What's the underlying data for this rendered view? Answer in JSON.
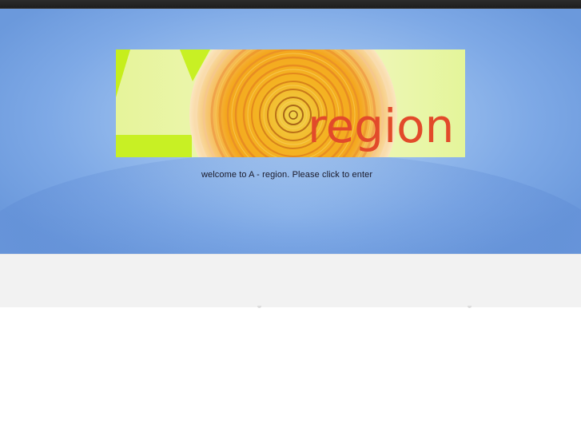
{
  "banner": {
    "logo_text": "region",
    "colors": {
      "lime": "#c8f024",
      "pale_green": "#e9f7a2",
      "orange": "#f4a21e",
      "swirl_center": "#f1c232",
      "text_red": "#e24a2a"
    }
  },
  "welcome": {
    "text": "welcome to A - region. Please click to enter"
  },
  "colors": {
    "top_bar": "#232323",
    "hero_blue": "#8db5ec",
    "band_grey": "#f2f2f2"
  }
}
